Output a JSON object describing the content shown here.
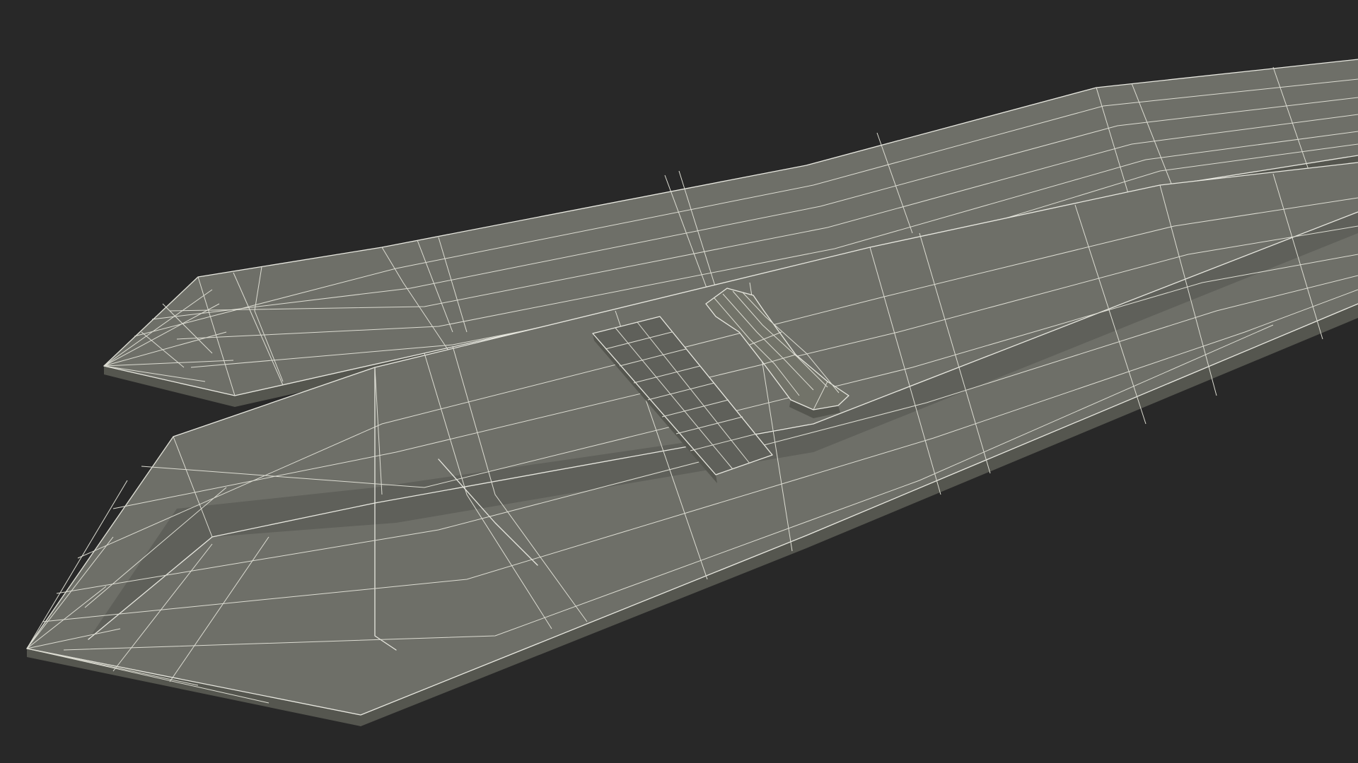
{
  "scene": {
    "subject": "necktie-wireframe-model",
    "background_color": "#282828",
    "surface_color": "#6e6f68",
    "wire_color": "#e8e8e0",
    "parts": [
      "narrow-blade",
      "wide-blade",
      "keeper-loop-patch",
      "keeper-loop-strap"
    ]
  }
}
